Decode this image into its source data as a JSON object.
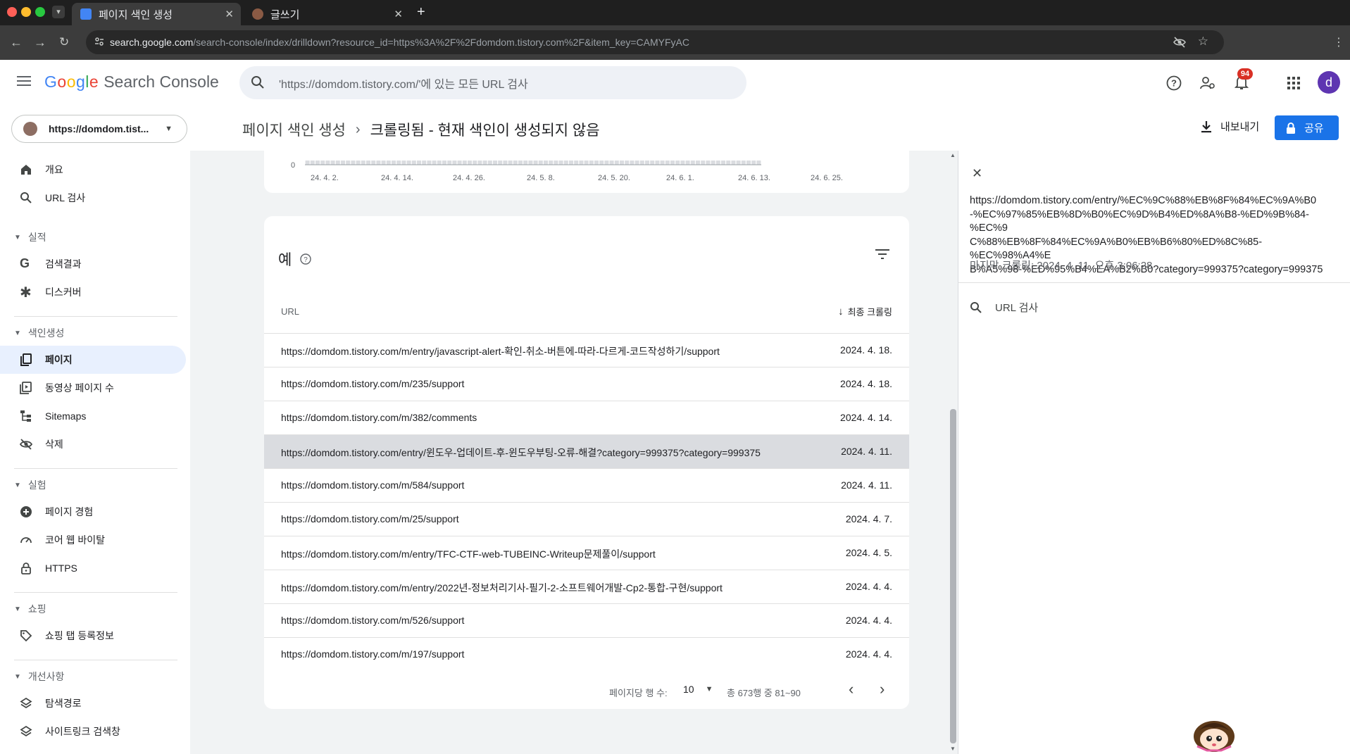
{
  "browser": {
    "tabs": [
      {
        "title": "페이지 색인 생성",
        "active": true
      },
      {
        "title": "글쓰기",
        "active": false
      }
    ],
    "url_host": "search.google.com",
    "url_path": "/search-console/index/drilldown?resource_id=https%3A%2F%2Fdomdom.tistory.com%2F&item_key=CAMYFyAC"
  },
  "header": {
    "logo_google": "Google",
    "logo_product": "Search Console",
    "search_placeholder": "'https://domdom.tistory.com/'에 있는 모든 URL 검사",
    "notification_count": "94",
    "avatar_letter": "d"
  },
  "sidebar": {
    "property": "https://domdom.tist...",
    "items_top": [
      {
        "label": "개요",
        "icon": "home-icon"
      },
      {
        "label": "URL 검사",
        "icon": "search-icon"
      }
    ],
    "sections": [
      {
        "title": "실적",
        "items": [
          {
            "label": "검색결과",
            "icon": "google-g-icon"
          },
          {
            "label": "디스커버",
            "icon": "asterisk-icon"
          }
        ]
      },
      {
        "title": "색인생성",
        "items": [
          {
            "label": "페이지",
            "icon": "pages-icon",
            "active": true
          },
          {
            "label": "동영상 페이지 수",
            "icon": "video-page-icon"
          },
          {
            "label": "Sitemaps",
            "icon": "sitemap-icon"
          },
          {
            "label": "삭제",
            "icon": "eye-off-icon"
          }
        ]
      },
      {
        "title": "실험",
        "items": [
          {
            "label": "페이지 경험",
            "icon": "plus-circle-icon"
          },
          {
            "label": "코어 웹 바이탈",
            "icon": "gauge-icon"
          },
          {
            "label": "HTTPS",
            "icon": "lock-icon"
          }
        ]
      },
      {
        "title": "쇼핑",
        "items": [
          {
            "label": "쇼핑 탭 등록정보",
            "icon": "tag-icon"
          }
        ]
      },
      {
        "title": "개선사항",
        "items": [
          {
            "label": "탐색경로",
            "icon": "layers-icon"
          },
          {
            "label": "사이트링크 검색창",
            "icon": "layers-icon"
          }
        ]
      }
    ]
  },
  "page": {
    "breadcrumb_parent": "페이지 색인 생성",
    "breadcrumb_current": "크롤링됨 - 현재 색인이 생성되지 않음",
    "export_label": "내보내기",
    "share_label": "공유"
  },
  "chart_data": {
    "type": "bar",
    "y_tick_label": "0",
    "x_tick_labels": [
      "24. 4. 2.",
      "24. 4. 14.",
      "24. 4. 26.",
      "24. 5. 8.",
      "24. 5. 20.",
      "24. 6. 1.",
      "24. 6. 13.",
      "24. 6. 25."
    ]
  },
  "examples": {
    "title": "예",
    "col_url": "URL",
    "col_date": "최종 크롤링",
    "rows": [
      {
        "url": "https://domdom.tistory.com/m/entry/javascript-alert-확인-취소-버튼에-따라-다르게-코드작성하기/support",
        "date": "2024. 4. 18."
      },
      {
        "url": "https://domdom.tistory.com/m/235/support",
        "date": "2024. 4. 18."
      },
      {
        "url": "https://domdom.tistory.com/m/382/comments",
        "date": "2024. 4. 14."
      },
      {
        "url": "https://domdom.tistory.com/entry/윈도우-업데이트-후-윈도우부팅-오류-해결?category=999375?category=999375",
        "date": "2024. 4. 11.",
        "selected": true
      },
      {
        "url": "https://domdom.tistory.com/m/584/support",
        "date": "2024. 4. 11."
      },
      {
        "url": "https://domdom.tistory.com/m/25/support",
        "date": "2024. 4. 7."
      },
      {
        "url": "https://domdom.tistory.com/m/entry/TFC-CTF-web-TUBEINC-Writeup문제풀이/support",
        "date": "2024. 4. 5."
      },
      {
        "url": "https://domdom.tistory.com/m/entry/2022년-정보처리기사-필기-2-소프트웨어개발-Cp2-통합-구현/support",
        "date": "2024. 4. 4."
      },
      {
        "url": "https://domdom.tistory.com/m/526/support",
        "date": "2024. 4. 4."
      },
      {
        "url": "https://domdom.tistory.com/m/197/support",
        "date": "2024. 4. 4."
      }
    ],
    "rows_per_page_label": "페이지당 행 수:",
    "rows_per_page_value": "10",
    "range_label": "총 673행 중 81~90"
  },
  "panel": {
    "url_lines": [
      "https://domdom.tistory.com/entry/%EC%9C%88%EB%8F%84%EC%9A%B0",
      "-%EC%97%85%EB%8D%B0%EC%9D%B4%ED%8A%B8-%ED%9B%84-%EC%9",
      "C%88%EB%8F%84%EC%9A%B0%EB%B6%80%ED%8C%85-%EC%98%A4%E",
      "B%A5%98-%ED%95%B4%EA%B2%B0?category=999375?category=999375"
    ],
    "last_crawl": "마지막 크롤링: 2024. 4. 11. 오후 3:06:28",
    "inspect_label": "URL 검사"
  },
  "colors": {
    "accent": "#1a73e8",
    "active_nav": "#e8f0fe",
    "badge": "#d93025"
  }
}
